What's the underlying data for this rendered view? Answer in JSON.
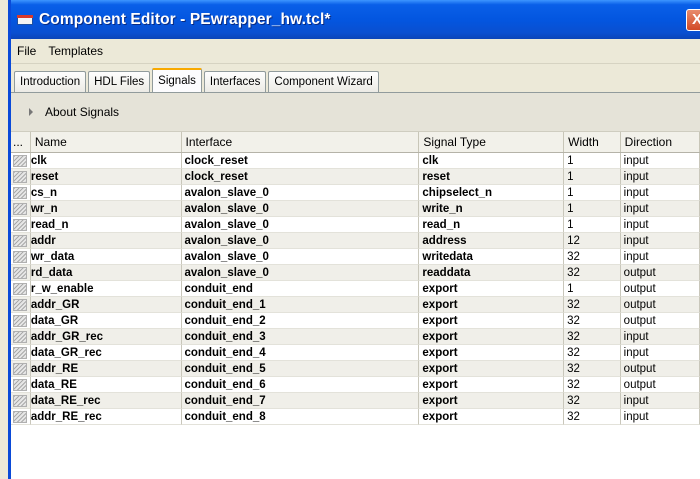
{
  "window": {
    "title": "Component Editor - PEwrapper_hw.tcl*",
    "close_glyph": "X"
  },
  "menu": [
    "File",
    "Templates"
  ],
  "tabs": [
    {
      "label": "Introduction",
      "active": false
    },
    {
      "label": "HDL Files",
      "active": false
    },
    {
      "label": "Signals",
      "active": true
    },
    {
      "label": "Interfaces",
      "active": false
    },
    {
      "label": "Component Wizard",
      "active": false
    }
  ],
  "about": {
    "label": "About Signals"
  },
  "table": {
    "columns": [
      "...",
      "Name",
      "Interface",
      "Signal Type",
      "Width",
      "Direction"
    ],
    "rows": [
      {
        "name": "clk",
        "interface": "clock_reset",
        "signal_type": "clk",
        "width": "1",
        "direction": "input"
      },
      {
        "name": "reset",
        "interface": "clock_reset",
        "signal_type": "reset",
        "width": "1",
        "direction": "input"
      },
      {
        "name": "cs_n",
        "interface": "avalon_slave_0",
        "signal_type": "chipselect_n",
        "width": "1",
        "direction": "input"
      },
      {
        "name": "wr_n",
        "interface": "avalon_slave_0",
        "signal_type": "write_n",
        "width": "1",
        "direction": "input"
      },
      {
        "name": "read_n",
        "interface": "avalon_slave_0",
        "signal_type": "read_n",
        "width": "1",
        "direction": "input"
      },
      {
        "name": "addr",
        "interface": "avalon_slave_0",
        "signal_type": "address",
        "width": "12",
        "direction": "input"
      },
      {
        "name": "wr_data",
        "interface": "avalon_slave_0",
        "signal_type": "writedata",
        "width": "32",
        "direction": "input"
      },
      {
        "name": "rd_data",
        "interface": "avalon_slave_0",
        "signal_type": "readdata",
        "width": "32",
        "direction": "output"
      },
      {
        "name": "r_w_enable",
        "interface": "conduit_end",
        "signal_type": "export",
        "width": "1",
        "direction": "output"
      },
      {
        "name": "addr_GR",
        "interface": "conduit_end_1",
        "signal_type": "export",
        "width": "32",
        "direction": "output"
      },
      {
        "name": "data_GR",
        "interface": "conduit_end_2",
        "signal_type": "export",
        "width": "32",
        "direction": "output"
      },
      {
        "name": "addr_GR_rec",
        "interface": "conduit_end_3",
        "signal_type": "export",
        "width": "32",
        "direction": "input"
      },
      {
        "name": "data_GR_rec",
        "interface": "conduit_end_4",
        "signal_type": "export",
        "width": "32",
        "direction": "input"
      },
      {
        "name": "addr_RE",
        "interface": "conduit_end_5",
        "signal_type": "export",
        "width": "32",
        "direction": "output"
      },
      {
        "name": "data_RE",
        "interface": "conduit_end_6",
        "signal_type": "export",
        "width": "32",
        "direction": "output"
      },
      {
        "name": "data_RE_rec",
        "interface": "conduit_end_7",
        "signal_type": "export",
        "width": "32",
        "direction": "input"
      },
      {
        "name": "addr_RE_rec",
        "interface": "conduit_end_8",
        "signal_type": "export",
        "width": "32",
        "direction": "input"
      }
    ]
  }
}
